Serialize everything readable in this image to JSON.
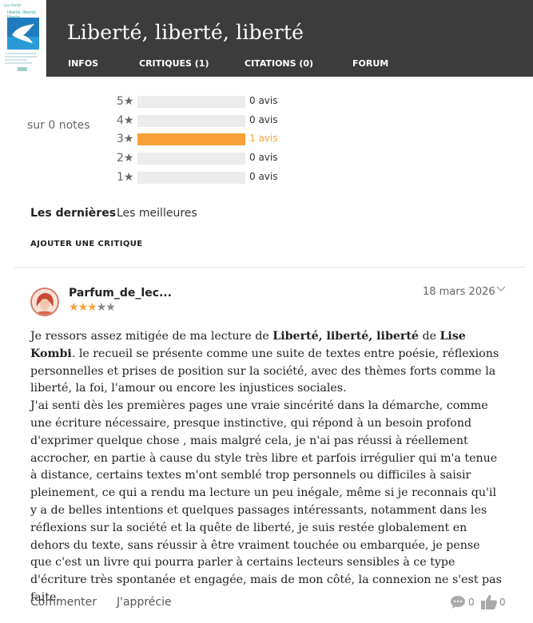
{
  "header": {
    "book_title": "Liberté, liberté, liberté",
    "cover": {
      "author": "Lise Kombi",
      "title": "liberté, liberté, liberté"
    },
    "nav": [
      {
        "label": "INFOS"
      },
      {
        "label": "CRITIQUES (1)"
      },
      {
        "label": "CITATIONS (0)"
      },
      {
        "label": "FORUM"
      }
    ]
  },
  "ratings": {
    "summary": "sur 0 notes",
    "rows": [
      {
        "label": "5★",
        "count": "0 avis",
        "fraction": 0
      },
      {
        "label": "4★",
        "count": "0 avis",
        "fraction": 0
      },
      {
        "label": "3★",
        "count": "1 avis",
        "fraction": 1
      },
      {
        "label": "2★",
        "count": "0 avis",
        "fraction": 0
      },
      {
        "label": "1★",
        "count": "0 avis",
        "fraction": 0
      }
    ],
    "accent_color": "#f7a035"
  },
  "sort": {
    "latest": "Les dernières",
    "best": "Les meilleures"
  },
  "add_review_label": "AJOUTER UNE CRITIQUE",
  "review": {
    "user": "Parfum_de_lec...",
    "rating": 3,
    "rating_max": 5,
    "date": "18 mars 2026",
    "text_intro_1": "Je ressors assez mitigée de ma lecture de ",
    "book_ref": "Liberté, liberté, liberté",
    "text_intro_2": " de ",
    "author_ref": "Lise Kombi",
    "text_intro_3": ". le recueil se présente comme une suite de textes entre poésie, réflexions personnelles et prises de position sur la société, avec des thèmes forts comme la liberté, la foi, l'amour ou encore les injustices sociales.",
    "paragraph_2": "J'ai senti dès les premières pages une vraie sincérité dans la démarche, comme une écriture nécessaire, presque instinctive, qui répond à un besoin profond d'exprimer quelque chose , mais malgré cela, je n'ai pas réussi à réellement accrocher, en partie à cause du style très libre et parfois irrégulier qui m'a tenue à distance, certains textes m'ont semblé trop personnels ou difficiles à saisir pleinement, ce qui a rendu ma lecture un peu inégale, même si je reconnais qu'il y a de belles intentions et quelques passages intéressants, notamment dans les réflexions sur la société et la quête de liberté, je suis restée globalement en dehors du texte, sans réussir à être vraiment touchée ou embarquée, je pense que c'est un livre qui pourra parler à certains lecteurs sensibles à ce type d'écriture très spontanée et engagée, mais de mon côté, la connexion ne s'est pas faite.",
    "comment_label": "Commenter",
    "like_label": "J'apprécie",
    "comment_count": "0",
    "like_count": "0"
  }
}
